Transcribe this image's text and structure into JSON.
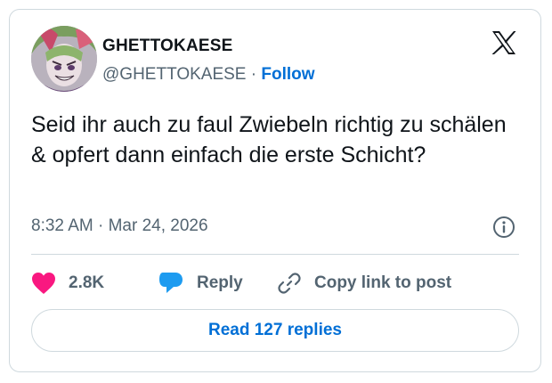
{
  "author": {
    "display_name": "GHETTOKAESE",
    "handle": "@GHETTOKAESE",
    "separator": "·",
    "follow_label": "Follow",
    "avatar_icon": "anime-avatar-icon"
  },
  "platform_icon": "x-logo-icon",
  "tweet": {
    "text": "Seid ihr auch zu faul Zwiebeln richtig zu schälen & opfert dann einfach die erste Schicht?",
    "time": "8:32 AM",
    "separator": "·",
    "date": "Mar 24, 2026"
  },
  "actions": {
    "like_count": "2.8K",
    "reply_label": "Reply",
    "copy_label": "Copy link to post"
  },
  "read_replies_label": "Read 127 replies",
  "colors": {
    "accent": "#006fd6",
    "like": "#f91880",
    "reply_icon": "#1d9bf0",
    "secondary_text": "#536471",
    "border": "#cfd9de"
  }
}
